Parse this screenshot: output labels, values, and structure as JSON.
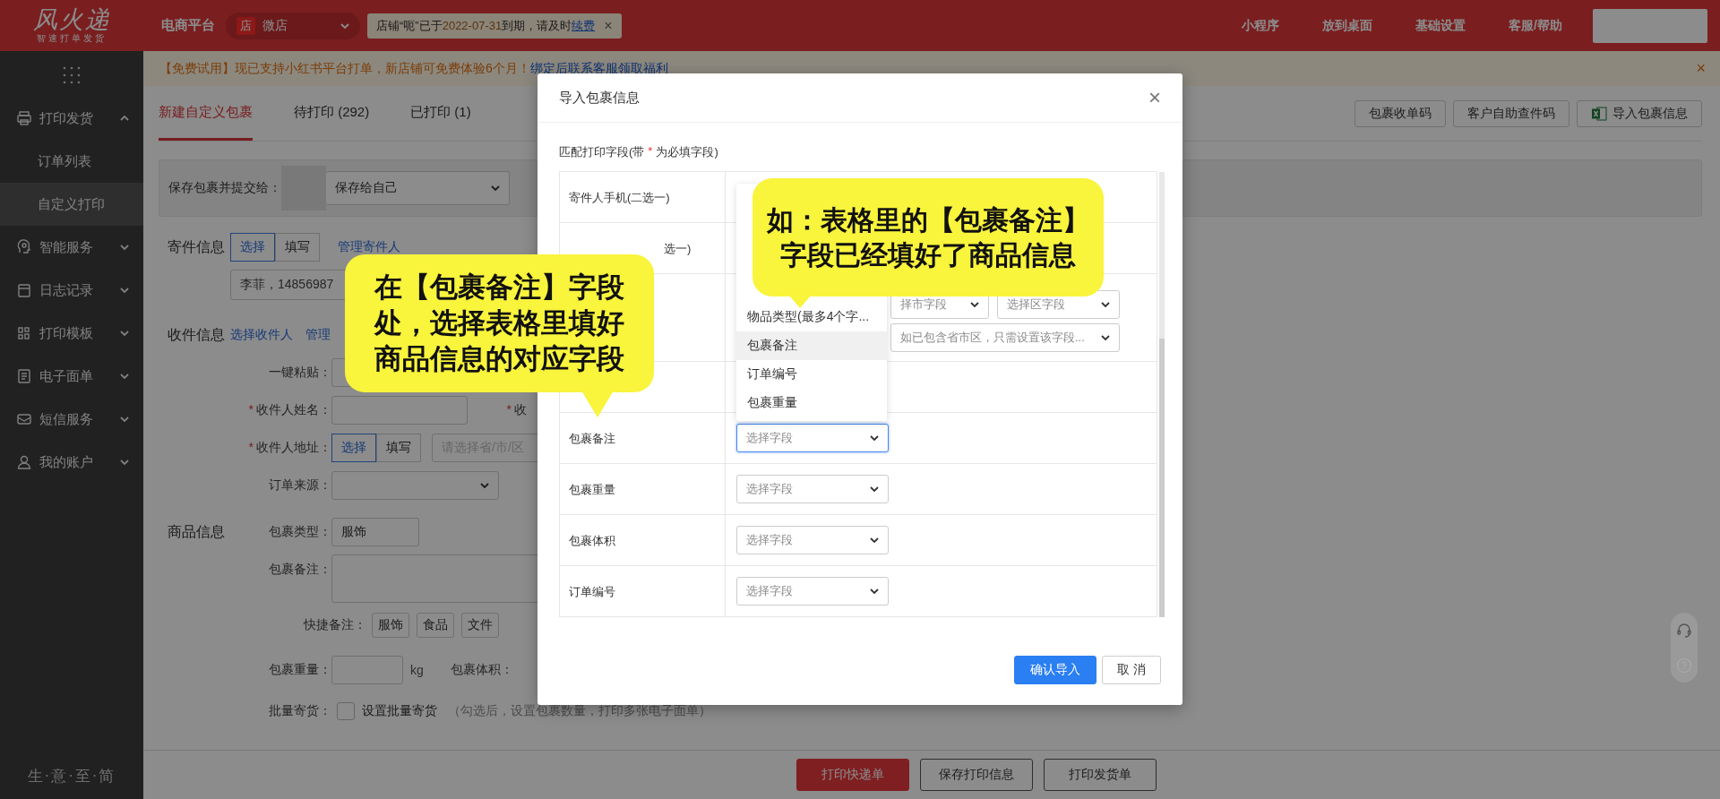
{
  "topbar": {
    "logo": "风火递",
    "logo_tagline": "智速打单发货",
    "platform_label": "电商平台",
    "shop_badge": "店",
    "shop_name": "微店",
    "notice": {
      "before": "店铺“呃”已于",
      "date": "2022-07-31",
      "after": "到期，请及时",
      "link": "续费",
      "close": "×"
    },
    "nav": [
      "小程序",
      "放到桌面",
      "基础设置",
      "客服/帮助"
    ]
  },
  "sidebar": {
    "items": [
      {
        "label": "打印发货",
        "expanded": true,
        "children": [
          {
            "label": "订单列表",
            "selected": false
          },
          {
            "label": "自定义打印",
            "selected": true
          }
        ]
      },
      {
        "label": "智能服务",
        "expanded": false
      },
      {
        "label": "日志记录",
        "expanded": false
      },
      {
        "label": "打印模板",
        "expanded": false
      },
      {
        "label": "电子面单",
        "expanded": false
      },
      {
        "label": "短信服务",
        "expanded": false
      },
      {
        "label": "我的账户",
        "expanded": false
      }
    ],
    "footer": "生·意·至·简"
  },
  "banner": {
    "text": "【免费试用】现已支持小红书平台打单，新店铺可免费体验6个月！",
    "link": "绑定后联系客服领取福利",
    "close": "×"
  },
  "tabs": [
    {
      "label": "新建自定义包裹",
      "selected": true
    },
    {
      "label": "待打印 (292)",
      "selected": false
    },
    {
      "label": "已打印 (1)",
      "selected": false
    }
  ],
  "toolbar_buttons": [
    {
      "label": "包裹收单码",
      "kind": "plain"
    },
    {
      "label": "客户自助查件码",
      "kind": "plain"
    },
    {
      "label": "导入包裹信息",
      "kind": "excel"
    }
  ],
  "submit_to": {
    "label": "保存包裹并提交给：",
    "select": "保存给自己"
  },
  "sender": {
    "title": "寄件信息",
    "modes": [
      {
        "label": "选择",
        "selected": true
      },
      {
        "label": "填写",
        "selected": false
      }
    ],
    "manage_link": "管理寄件人",
    "value": "李菲，14856987"
  },
  "recipient": {
    "title": "收件信息",
    "links": [
      "选择收件人",
      "管理"
    ],
    "paste_label": "一键粘贴：",
    "name_label": "收件人姓名：",
    "phone_label": "收",
    "address_label": "收件人地址：",
    "address_modes": [
      {
        "label": "选择",
        "selected": true
      },
      {
        "label": "填写",
        "selected": false
      }
    ],
    "address_placeholder": "请选择省/市/区",
    "source_label": "订单来源："
  },
  "goods": {
    "title": "商品信息",
    "type_label": "包裹类型：",
    "type_value": "服饰",
    "note_label": "包裹备注：",
    "quick_label": "快捷备注：",
    "quick": [
      "服饰",
      "食品",
      "文件"
    ],
    "weight_label": "包裹重量：",
    "weight_unit": "kg",
    "volume_label": "包裹体积：",
    "batch_label": "批量寄货：",
    "batch_checked": false,
    "batch_text": "设置批量寄货",
    "batch_hint": "（勾选后，设置包裹数量，打印多张电子面单）"
  },
  "bottom_buttons": [
    {
      "label": "打印快递单",
      "kind": "primary"
    },
    {
      "label": "保存打印信息",
      "kind": "default"
    },
    {
      "label": "打印发货单",
      "kind": "default"
    }
  ],
  "modal": {
    "title": "导入包裹信息",
    "close": "×",
    "hint_before": "匹配打印字段(带",
    "hint_mark": "*",
    "hint_after": "为必填字段)",
    "rows": [
      {
        "label": "寄件人手机(二选一)",
        "kind": "single"
      },
      {
        "label": "选一)",
        "kind": "single"
      },
      {
        "kind": "address",
        "selects": [
          {
            "placeholder": "择市字段"
          },
          {
            "placeholder": "选择区字段"
          }
        ],
        "wide_select": {
          "placeholder": "如已包含省市区，只需设置该字段..."
        }
      },
      {
        "kind": "single"
      },
      {
        "label": "包裹备注",
        "kind": "single",
        "select": {
          "placeholder": "选择字段",
          "focused": true
        }
      },
      {
        "label": "包裹重量",
        "kind": "single",
        "select": {
          "placeholder": "选择字段",
          "focused": false
        }
      },
      {
        "label": "包裹体积",
        "kind": "single",
        "select": {
          "placeholder": "选择字段",
          "focused": false
        }
      },
      {
        "label": "订单编号",
        "kind": "single",
        "select": {
          "placeholder": "选择字段",
          "focused": false
        }
      }
    ],
    "buttons": [
      {
        "label": "确认导入",
        "kind": "primary"
      },
      {
        "label": "取 消",
        "kind": "default"
      }
    ]
  },
  "dropdown": {
    "items": [
      {
        "label": "物品类型(最多4个字...",
        "highlighted": false
      },
      {
        "label": "包裹备注",
        "highlighted": true
      },
      {
        "label": "订单编号",
        "highlighted": false
      },
      {
        "label": "包裹重量",
        "highlighted": false
      }
    ]
  },
  "callouts": [
    {
      "text": "如：表格里的【包裹备注】字段已经填好了商品信息"
    },
    {
      "text": "在【包裹备注】字段处，选择表格里填好商品信息的对应字段"
    }
  ]
}
